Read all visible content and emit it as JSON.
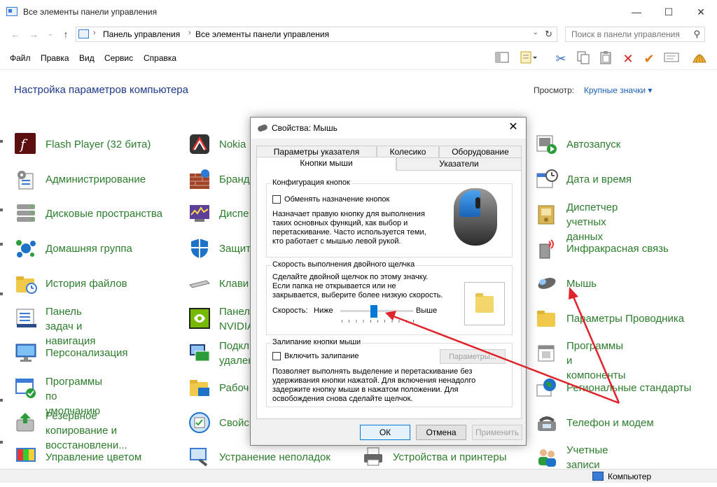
{
  "window": {
    "title": "Все элементы панели управления",
    "minimize": "—",
    "maximize": "☐",
    "close": "✕"
  },
  "address": {
    "back": "←",
    "forward": "→",
    "dropdown": "⌄",
    "up": "↑",
    "crumbs": [
      "Панель управления",
      "Все элементы панели управления"
    ],
    "separator": "›",
    "refresh": "↻",
    "search_placeholder": "Поиск в панели управления",
    "search_icon": "⚲"
  },
  "menu": [
    "Файл",
    "Правка",
    "Вид",
    "Сервис",
    "Справка"
  ],
  "toolbar_icons": [
    "pane-icon",
    "properties-icon",
    "cut-icon",
    "copy-icon",
    "paste-icon",
    "delete-icon",
    "check-icon",
    "mail-icon",
    "shell-icon"
  ],
  "heading": "Настройка параметров компьютера",
  "view": {
    "label": "Просмотр:",
    "value": "Крупные значки ▾"
  },
  "columns": [
    {
      "items": [
        {
          "label": "Flash Player (32 бита)",
          "icon": "flash-icon"
        },
        {
          "label": "Администрирование",
          "icon": "admin-tools-icon"
        },
        {
          "label": "Дисковые пространства",
          "icon": "storage-spaces-icon"
        },
        {
          "label": "Домашняя группа",
          "icon": "homegroup-icon"
        },
        {
          "label": "История файлов",
          "icon": "file-history-icon"
        },
        {
          "label": "Панель задач и\nнавигация",
          "icon": "taskbar-icon"
        },
        {
          "label": "Персонализация",
          "icon": "personalization-icon"
        },
        {
          "label": "Программы по\nумолчанию",
          "icon": "default-programs-icon"
        },
        {
          "label": "Резервное копирование и\nвосстановлени...",
          "icon": "backup-icon"
        },
        {
          "label": "Управление цветом",
          "icon": "color-management-icon"
        }
      ]
    },
    {
      "items": [
        {
          "label": "Nokia",
          "icon": "nokia-icon"
        },
        {
          "label": "Бранд",
          "icon": "firewall-icon"
        },
        {
          "label": "Диспе",
          "icon": "device-manager-icon"
        },
        {
          "label": "Защит",
          "icon": "security-icon"
        },
        {
          "label": "Клави",
          "icon": "keyboard-icon"
        },
        {
          "label": "Панел\nNVIDIA",
          "icon": "nvidia-icon"
        },
        {
          "label": "Подкл\nудален",
          "icon": "remote-icon"
        },
        {
          "label": "Рабоч",
          "icon": "work-folders-icon"
        },
        {
          "label": "Свойс",
          "icon": "properties-cp-icon"
        },
        {
          "label": "Устранение неполадок",
          "icon": "troubleshoot-icon"
        }
      ]
    },
    {
      "items": [
        {
          "label": "Устройства и принтеры",
          "icon": "printer-icon"
        }
      ]
    },
    {
      "items": [
        {
          "label": "Автозапуск",
          "icon": "autoplay-icon"
        },
        {
          "label": "Дата и время",
          "icon": "datetime-icon"
        },
        {
          "label": "Диспетчер учетных\nданных",
          "icon": "credential-manager-icon"
        },
        {
          "label": "Инфракрасная связь",
          "icon": "infrared-icon"
        },
        {
          "label": "Мышь",
          "icon": "mouse-icon"
        },
        {
          "label": "Параметры Проводника",
          "icon": "explorer-options-icon"
        },
        {
          "label": "Программы и\nкомпоненты",
          "icon": "programs-features-icon"
        },
        {
          "label": "Региональные стандарты",
          "icon": "region-icon"
        },
        {
          "label": "Телефон и модем",
          "icon": "phone-modem-icon"
        },
        {
          "label": "Учетные записи\nпользователей",
          "icon": "user-accounts-icon"
        }
      ]
    }
  ],
  "status": {
    "label": "Компьютер"
  },
  "dialog": {
    "title": "Свойства: Мышь",
    "close": "✕",
    "tabs_back": [
      "Параметры указателя",
      "Колесико",
      "Оборудование"
    ],
    "tabs_front": [
      "Кнопки мыши",
      "Указатели"
    ],
    "active_tab": "Кнопки мыши",
    "group1": {
      "title": "Конфигурация кнопок",
      "checkbox": "Обменять назначение кнопок",
      "description": [
        "Назначает правую кнопку для выполнения",
        "таких основных функций, как выбор и",
        "перетаскивание. Часто используется теми,",
        "кто работает с мышью левой рукой."
      ]
    },
    "group2": {
      "title": "Скорость выполнения двойного щелчка",
      "description": [
        "Сделайте двойной щелчок по этому значку.",
        "Если папка не открывается или не",
        "закрывается, выберите более низкую скорость."
      ],
      "speed_label": "Скорость:",
      "low": "Ниже",
      "high": "Выше",
      "speed_level": 0.45
    },
    "group3": {
      "title": "Залипание кнопки мыши",
      "checkbox": "Включить залипание",
      "settings_button": "Параметры...",
      "description": [
        "Позволяет выполнять выделение и перетаскивание без",
        "удерживания кнопки нажатой. Для включения ненадолго",
        "задержите кнопку мыши в нажатом положении. Для",
        "освобождения снова сделайте щелчок."
      ]
    },
    "buttons": {
      "ok": "ОК",
      "cancel": "Отмена",
      "apply": "Применить"
    }
  },
  "colors": {
    "link_green": "#2d7d2d",
    "heading_blue": "#1e3a8a",
    "accent": "#0078d7",
    "arrow_red": "#e0242b"
  }
}
